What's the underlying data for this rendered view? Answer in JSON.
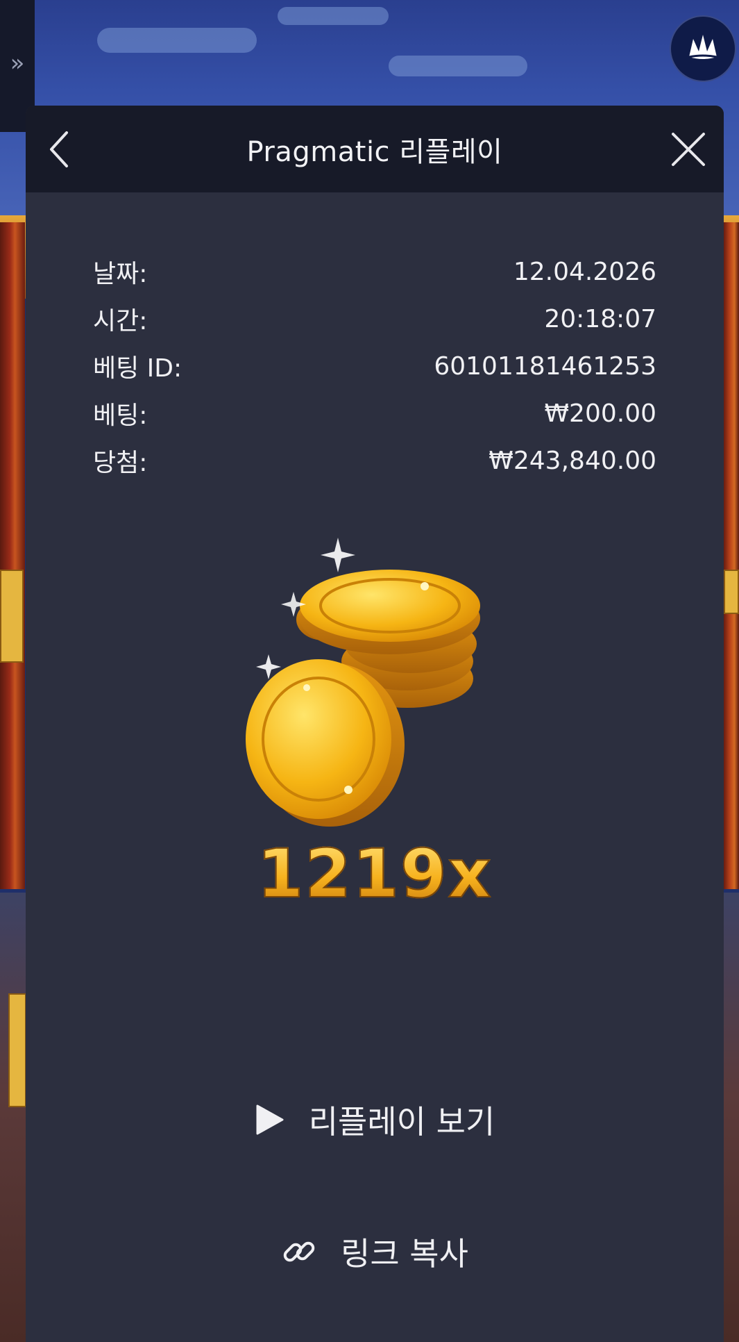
{
  "modal": {
    "title": "Pragmatic 리플레이"
  },
  "details": [
    {
      "label": "날짜:",
      "value": "12.04.2026"
    },
    {
      "label": "시간:",
      "value": "20:18:07"
    },
    {
      "label": "베팅 ID:",
      "value": "60101181461253"
    },
    {
      "label": "베팅:",
      "value": "₩200.00"
    },
    {
      "label": "당첨:",
      "value": "₩243,840.00"
    }
  ],
  "result": {
    "multiplier": "1219x"
  },
  "actions": {
    "replay_label": "리플레이 보기",
    "copy_link_label": "링크 복사"
  },
  "icons": {
    "sidebar": "double-chevron-right-icon",
    "brand": "crown-logo-icon",
    "back": "chevron-left-icon",
    "close": "close-icon",
    "play": "play-icon",
    "link": "link-icon"
  },
  "colors": {
    "modal_bg": "#2c2f3f",
    "header_bg": "#171a28",
    "text": "#f1f1f4",
    "gold": "#f7b21e"
  }
}
